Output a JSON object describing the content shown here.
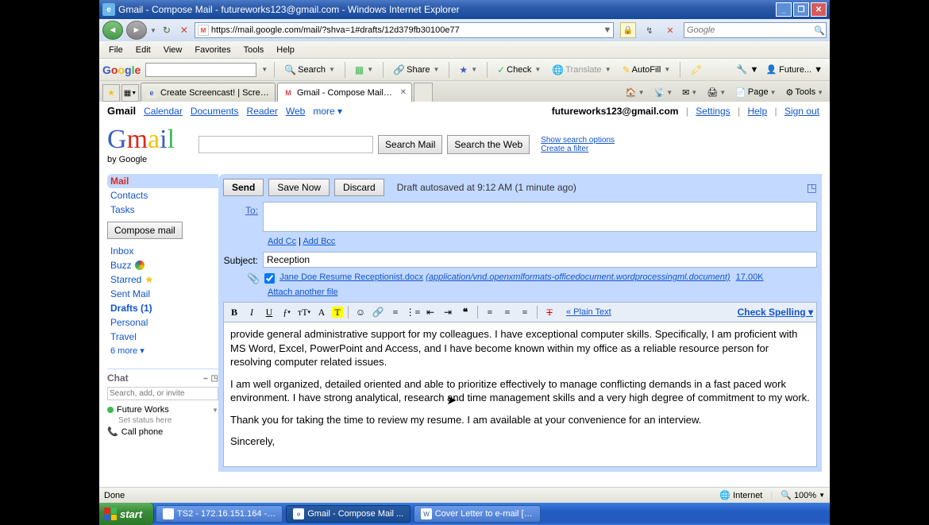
{
  "window": {
    "title": "Gmail - Compose Mail - futureworks123@gmail.com - Windows Internet Explorer",
    "minimize": "_",
    "restore": "❐",
    "close": "✕"
  },
  "nav": {
    "url": "https://mail.google.com/mail/?shva=1#drafts/12d379fb30100e77",
    "search_placeholder": "Google",
    "lock": "🔒"
  },
  "menubar": {
    "file": "File",
    "edit": "Edit",
    "view": "View",
    "favorites": "Favorites",
    "tools": "Tools",
    "help": "Help"
  },
  "gtoolbar": {
    "search": "Search",
    "share": "Share",
    "check": "Check",
    "translate": "Translate",
    "autofill": "AutoFill",
    "signin": "Future..."
  },
  "tabs": {
    "tab1": "Create Screencast! | Screen...",
    "tab2": "Gmail - Compose Mail - fu..."
  },
  "cmdbar": {
    "page": "Page",
    "tools": "Tools"
  },
  "gm_nav": {
    "brand": "Gmail",
    "calendar": "Calendar",
    "documents": "Documents",
    "reader": "Reader",
    "web": "Web",
    "more": "more ▾",
    "email": "futureworks123@gmail.com",
    "settings": "Settings",
    "help": "Help",
    "signout": "Sign out"
  },
  "gm_search": {
    "btn1": "Search Mail",
    "btn2": "Search the Web",
    "opt1": "Show search options",
    "opt2": "Create a filter"
  },
  "sidebar": {
    "mail": "Mail",
    "contacts": "Contacts",
    "tasks": "Tasks",
    "compose": "Compose mail",
    "inbox": "Inbox",
    "buzz": "Buzz",
    "starred": "Starred",
    "sentmail": "Sent Mail",
    "drafts": "Drafts (1)",
    "personal": "Personal",
    "travel": "Travel",
    "more": "6 more ▾"
  },
  "chat": {
    "header": "Chat",
    "search_ph": "Search, add, or invite",
    "contact1": "Future Works",
    "status": "Set status here",
    "callphone": "Call phone"
  },
  "compose": {
    "send": "Send",
    "savenow": "Save Now",
    "discard": "Discard",
    "autosave": "Draft autosaved at 9:12 AM (1 minute ago)",
    "to_label": "To:",
    "addcc": "Add Cc",
    "addbcc": "Add Bcc",
    "subject_label": "Subject:",
    "subject_value": "Reception",
    "attach_name": "Jane Doe Resume Receptionist.docx",
    "attach_type": "(application/vnd.openxmlformats-officedocument.wordprocessingml.document)",
    "attach_size": "17.00K",
    "attach_another": "Attach another file",
    "plain": "« Plain Text",
    "spell": "Check Spelling ▾",
    "body_p1": "provide general administrative support for my colleagues. I have exceptional computer skills.  Specifically, I am proficient with MS Word, Excel, PowerPoint and Access, and I have become known within my office as a reliable resource person for resolving computer related issues.",
    "body_p2": "I am well organized, detailed oriented and able to prioritize effectively to manage conflicting demands in a fast paced work environment. I have strong analytical, research and time management skills and a very high degree of commitment to my work.",
    "body_p3": "Thank you for taking the time to review my resume.  I am available at your convenience for an interview.",
    "body_p4": "Sincerely,"
  },
  "statusbar": {
    "done": "Done",
    "internet": "Internet",
    "zoom": "100%"
  },
  "taskbar": {
    "start": "start",
    "task1": "TS2 - 172.16.151.164 - ...",
    "task2": "Gmail - Compose Mail ...",
    "task3": "Cover Letter to e-mail [C..."
  }
}
